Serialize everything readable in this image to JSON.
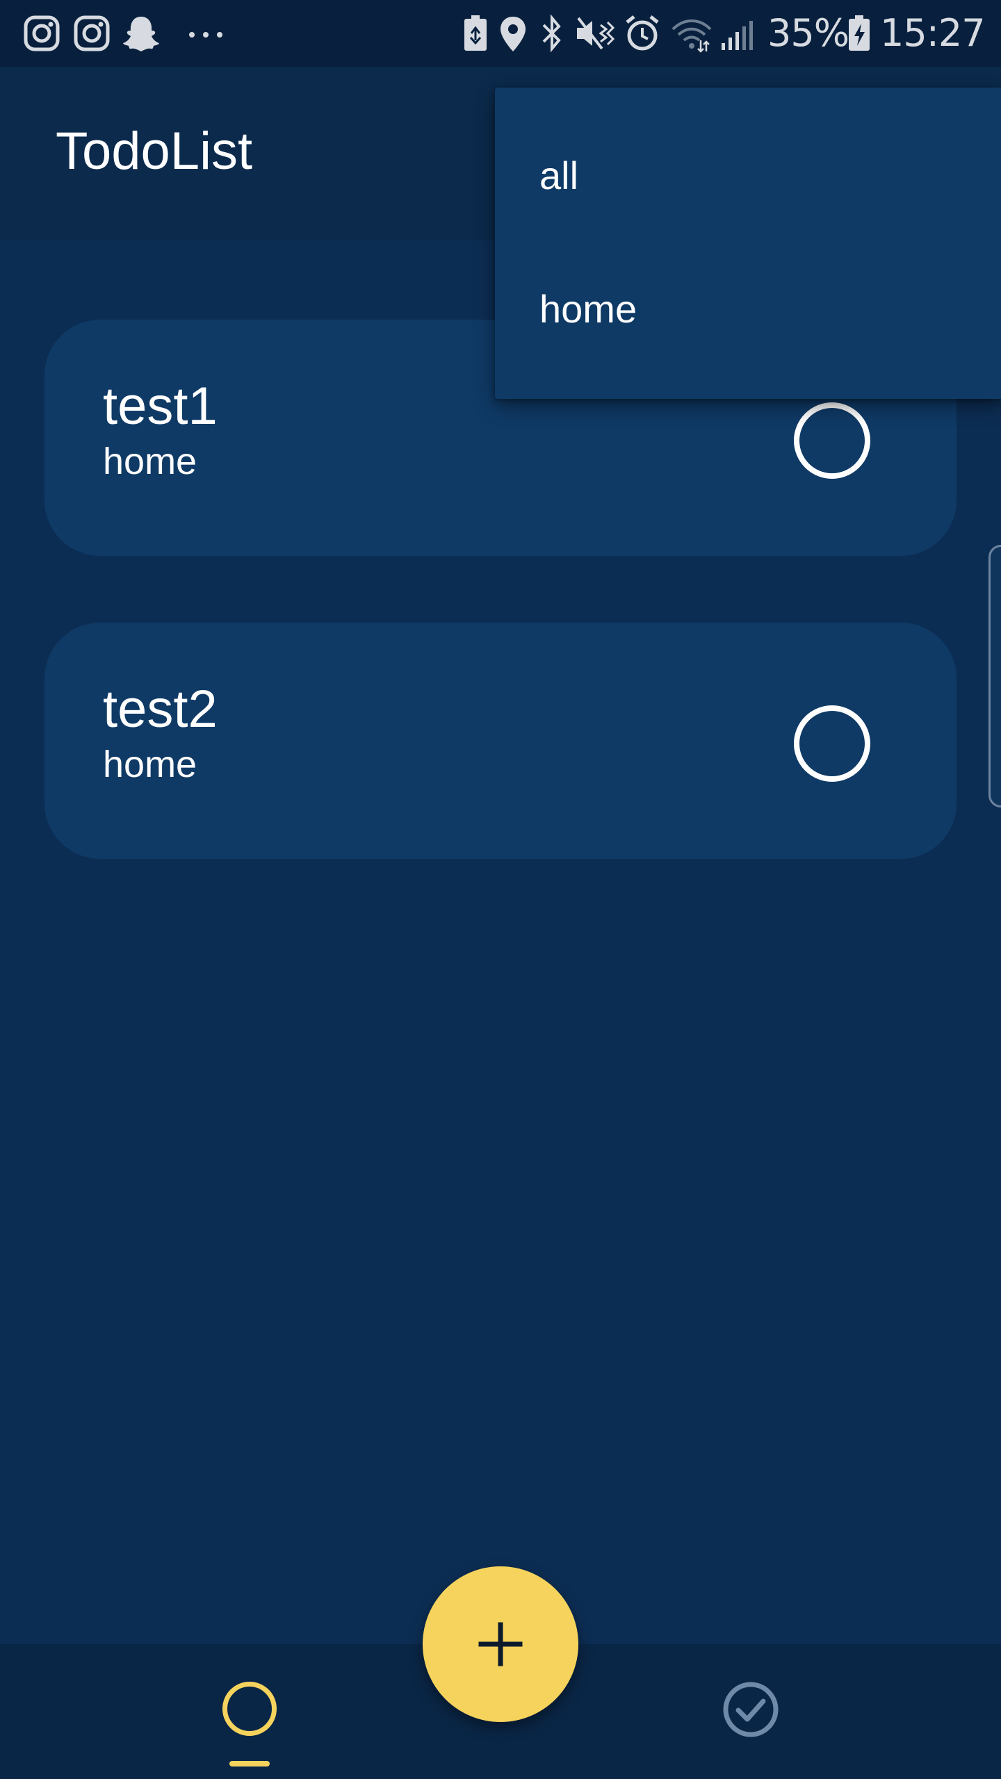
{
  "status_bar": {
    "notifications": [
      "instagram-icon",
      "instagram-icon",
      "snapchat-icon",
      "more-icon"
    ],
    "system_icons": [
      "battery-saver-icon",
      "location-icon",
      "bluetooth-icon",
      "mute-vibrate-icon",
      "alarm-icon",
      "wifi-icon",
      "signal-icon"
    ],
    "battery_percent": "35%",
    "time": "15:27"
  },
  "app_bar": {
    "title": "TodoList"
  },
  "todos": [
    {
      "title": "test1",
      "tag": "home",
      "done": false
    },
    {
      "title": "test2",
      "tag": "home",
      "done": false
    }
  ],
  "filter_menu": {
    "items": [
      {
        "label": "all"
      },
      {
        "label": "home"
      }
    ]
  },
  "bottom_nav": {
    "items": [
      {
        "icon": "circle-icon",
        "active": true
      },
      {
        "icon": "check-circle-icon",
        "active": false
      }
    ],
    "fab_icon": "plus-icon"
  },
  "colors": {
    "background": "#0c2d53",
    "card": "#0f3a66",
    "app_bar": "#0b2a4c",
    "status_bar": "#08203d",
    "accent": "#f5d35c",
    "inactive_icon": "#6f89a8"
  }
}
